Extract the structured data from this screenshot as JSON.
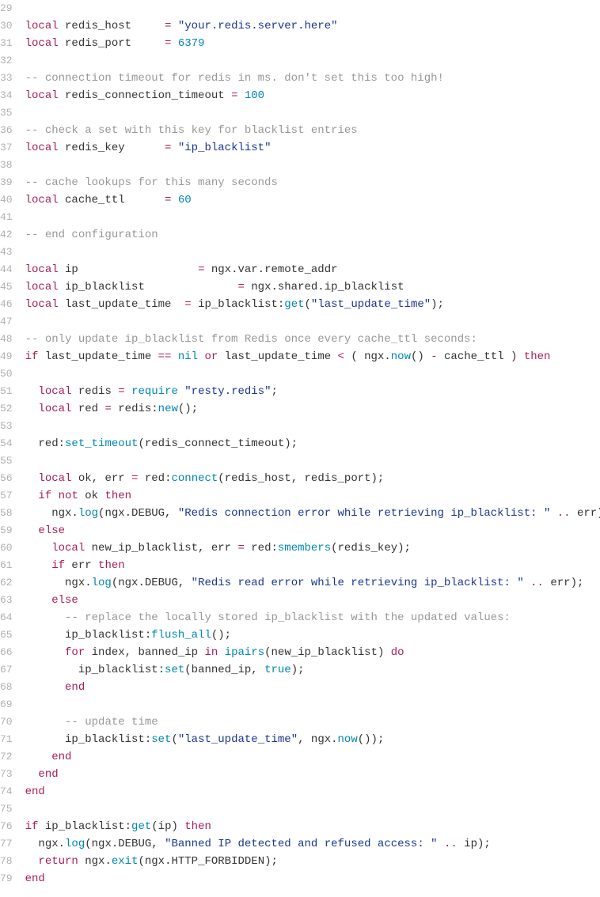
{
  "lines": [
    {
      "n": 29,
      "t": []
    },
    {
      "n": 30,
      "t": [
        {
          "c": "kw",
          "s": "local"
        },
        {
          "c": "id",
          "s": " redis_host     "
        },
        {
          "c": "op",
          "s": "="
        },
        {
          "c": "id",
          "s": " "
        },
        {
          "c": "str",
          "s": "\"your.redis.server.here\""
        }
      ]
    },
    {
      "n": 31,
      "t": [
        {
          "c": "kw",
          "s": "local"
        },
        {
          "c": "id",
          "s": " redis_port     "
        },
        {
          "c": "op",
          "s": "="
        },
        {
          "c": "id",
          "s": " "
        },
        {
          "c": "num",
          "s": "6379"
        }
      ]
    },
    {
      "n": 32,
      "t": []
    },
    {
      "n": 33,
      "t": [
        {
          "c": "com",
          "s": "-- connection timeout for redis in ms. don't set this too high!"
        }
      ]
    },
    {
      "n": 34,
      "t": [
        {
          "c": "kw",
          "s": "local"
        },
        {
          "c": "id",
          "s": " redis_connection_timeout "
        },
        {
          "c": "op",
          "s": "="
        },
        {
          "c": "id",
          "s": " "
        },
        {
          "c": "num",
          "s": "100"
        }
      ]
    },
    {
      "n": 35,
      "t": []
    },
    {
      "n": 36,
      "t": [
        {
          "c": "com",
          "s": "-- check a set with this key for blacklist entries"
        }
      ]
    },
    {
      "n": 37,
      "t": [
        {
          "c": "kw",
          "s": "local"
        },
        {
          "c": "id",
          "s": " redis_key      "
        },
        {
          "c": "op",
          "s": "="
        },
        {
          "c": "id",
          "s": " "
        },
        {
          "c": "str",
          "s": "\"ip_blacklist\""
        }
      ]
    },
    {
      "n": 38,
      "t": []
    },
    {
      "n": 39,
      "t": [
        {
          "c": "com",
          "s": "-- cache lookups for this many seconds"
        }
      ]
    },
    {
      "n": 40,
      "t": [
        {
          "c": "kw",
          "s": "local"
        },
        {
          "c": "id",
          "s": " cache_ttl      "
        },
        {
          "c": "op",
          "s": "="
        },
        {
          "c": "id",
          "s": " "
        },
        {
          "c": "num",
          "s": "60"
        }
      ]
    },
    {
      "n": 41,
      "t": []
    },
    {
      "n": 42,
      "t": [
        {
          "c": "com",
          "s": "-- end configuration"
        }
      ]
    },
    {
      "n": 43,
      "t": []
    },
    {
      "n": 44,
      "t": [
        {
          "c": "kw",
          "s": "local"
        },
        {
          "c": "id",
          "s": " ip                  "
        },
        {
          "c": "op",
          "s": "="
        },
        {
          "c": "id",
          "s": " ngx.var.remote_addr"
        }
      ]
    },
    {
      "n": 45,
      "t": [
        {
          "c": "kw",
          "s": "local"
        },
        {
          "c": "id",
          "s": " ip_blacklist              "
        },
        {
          "c": "op",
          "s": "="
        },
        {
          "c": "id",
          "s": " ngx.shared.ip_blacklist"
        }
      ]
    },
    {
      "n": 46,
      "t": [
        {
          "c": "kw",
          "s": "local"
        },
        {
          "c": "id",
          "s": " last_update_time  "
        },
        {
          "c": "op",
          "s": "="
        },
        {
          "c": "id",
          "s": " ip_blacklist:"
        },
        {
          "c": "fn",
          "s": "get"
        },
        {
          "c": "id",
          "s": "("
        },
        {
          "c": "str",
          "s": "\"last_update_time\""
        },
        {
          "c": "id",
          "s": ");"
        }
      ]
    },
    {
      "n": 47,
      "t": []
    },
    {
      "n": 48,
      "t": [
        {
          "c": "com",
          "s": "-- only update ip_blacklist from Redis once every cache_ttl seconds:"
        }
      ]
    },
    {
      "n": 49,
      "t": [
        {
          "c": "kw",
          "s": "if"
        },
        {
          "c": "id",
          "s": " last_update_time "
        },
        {
          "c": "op",
          "s": "=="
        },
        {
          "c": "id",
          "s": " "
        },
        {
          "c": "nil",
          "s": "nil"
        },
        {
          "c": "id",
          "s": " "
        },
        {
          "c": "kw",
          "s": "or"
        },
        {
          "c": "id",
          "s": " last_update_time "
        },
        {
          "c": "op",
          "s": "<"
        },
        {
          "c": "id",
          "s": " ( ngx."
        },
        {
          "c": "fn",
          "s": "now"
        },
        {
          "c": "id",
          "s": "() "
        },
        {
          "c": "op",
          "s": "-"
        },
        {
          "c": "id",
          "s": " cache_ttl ) "
        },
        {
          "c": "kw",
          "s": "then"
        }
      ]
    },
    {
      "n": 50,
      "t": []
    },
    {
      "n": 51,
      "t": [
        {
          "c": "id",
          "s": "  "
        },
        {
          "c": "kw",
          "s": "local"
        },
        {
          "c": "id",
          "s": " redis "
        },
        {
          "c": "op",
          "s": "="
        },
        {
          "c": "id",
          "s": " "
        },
        {
          "c": "fn",
          "s": "require"
        },
        {
          "c": "id",
          "s": " "
        },
        {
          "c": "str",
          "s": "\"resty.redis\""
        },
        {
          "c": "id",
          "s": ";"
        }
      ]
    },
    {
      "n": 52,
      "t": [
        {
          "c": "id",
          "s": "  "
        },
        {
          "c": "kw",
          "s": "local"
        },
        {
          "c": "id",
          "s": " red "
        },
        {
          "c": "op",
          "s": "="
        },
        {
          "c": "id",
          "s": " redis:"
        },
        {
          "c": "fn",
          "s": "new"
        },
        {
          "c": "id",
          "s": "();"
        }
      ]
    },
    {
      "n": 53,
      "t": []
    },
    {
      "n": 54,
      "t": [
        {
          "c": "id",
          "s": "  red:"
        },
        {
          "c": "fn",
          "s": "set_timeout"
        },
        {
          "c": "id",
          "s": "(redis_connect_timeout);"
        }
      ]
    },
    {
      "n": 55,
      "t": []
    },
    {
      "n": 56,
      "t": [
        {
          "c": "id",
          "s": "  "
        },
        {
          "c": "kw",
          "s": "local"
        },
        {
          "c": "id",
          "s": " ok, err "
        },
        {
          "c": "op",
          "s": "="
        },
        {
          "c": "id",
          "s": " red:"
        },
        {
          "c": "fn",
          "s": "connect"
        },
        {
          "c": "id",
          "s": "(redis_host, redis_port);"
        }
      ]
    },
    {
      "n": 57,
      "t": [
        {
          "c": "id",
          "s": "  "
        },
        {
          "c": "kw",
          "s": "if"
        },
        {
          "c": "id",
          "s": " "
        },
        {
          "c": "kw",
          "s": "not"
        },
        {
          "c": "id",
          "s": " ok "
        },
        {
          "c": "kw",
          "s": "then"
        }
      ]
    },
    {
      "n": 58,
      "t": [
        {
          "c": "id",
          "s": "    ngx."
        },
        {
          "c": "fn",
          "s": "log"
        },
        {
          "c": "id",
          "s": "(ngx.DEBUG, "
        },
        {
          "c": "str",
          "s": "\"Redis connection error while retrieving ip_blacklist: \""
        },
        {
          "c": "id",
          "s": " "
        },
        {
          "c": "op",
          "s": ".."
        },
        {
          "c": "id",
          "s": " err);"
        }
      ]
    },
    {
      "n": 59,
      "t": [
        {
          "c": "id",
          "s": "  "
        },
        {
          "c": "kw",
          "s": "else"
        }
      ]
    },
    {
      "n": 60,
      "t": [
        {
          "c": "id",
          "s": "    "
        },
        {
          "c": "kw",
          "s": "local"
        },
        {
          "c": "id",
          "s": " new_ip_blacklist, err "
        },
        {
          "c": "op",
          "s": "="
        },
        {
          "c": "id",
          "s": " red:"
        },
        {
          "c": "fn",
          "s": "smembers"
        },
        {
          "c": "id",
          "s": "(redis_key);"
        }
      ]
    },
    {
      "n": 61,
      "t": [
        {
          "c": "id",
          "s": "    "
        },
        {
          "c": "kw",
          "s": "if"
        },
        {
          "c": "id",
          "s": " err "
        },
        {
          "c": "kw",
          "s": "then"
        }
      ]
    },
    {
      "n": 62,
      "t": [
        {
          "c": "id",
          "s": "      ngx."
        },
        {
          "c": "fn",
          "s": "log"
        },
        {
          "c": "id",
          "s": "(ngx.DEBUG, "
        },
        {
          "c": "str",
          "s": "\"Redis read error while retrieving ip_blacklist: \""
        },
        {
          "c": "id",
          "s": " "
        },
        {
          "c": "op",
          "s": ".."
        },
        {
          "c": "id",
          "s": " err);"
        }
      ]
    },
    {
      "n": 63,
      "t": [
        {
          "c": "id",
          "s": "    "
        },
        {
          "c": "kw",
          "s": "else"
        }
      ]
    },
    {
      "n": 64,
      "t": [
        {
          "c": "id",
          "s": "      "
        },
        {
          "c": "com",
          "s": "-- replace the locally stored ip_blacklist with the updated values:"
        }
      ]
    },
    {
      "n": 65,
      "t": [
        {
          "c": "id",
          "s": "      ip_blacklist:"
        },
        {
          "c": "fn",
          "s": "flush_all"
        },
        {
          "c": "id",
          "s": "();"
        }
      ]
    },
    {
      "n": 66,
      "t": [
        {
          "c": "id",
          "s": "      "
        },
        {
          "c": "kw",
          "s": "for"
        },
        {
          "c": "id",
          "s": " index, banned_ip "
        },
        {
          "c": "kw",
          "s": "in"
        },
        {
          "c": "id",
          "s": " "
        },
        {
          "c": "fn",
          "s": "ipairs"
        },
        {
          "c": "id",
          "s": "(new_ip_blacklist) "
        },
        {
          "c": "kw",
          "s": "do"
        }
      ]
    },
    {
      "n": 67,
      "t": [
        {
          "c": "id",
          "s": "        ip_blacklist:"
        },
        {
          "c": "fn",
          "s": "set"
        },
        {
          "c": "id",
          "s": "(banned_ip, "
        },
        {
          "c": "bool",
          "s": "true"
        },
        {
          "c": "id",
          "s": ");"
        }
      ]
    },
    {
      "n": 68,
      "t": [
        {
          "c": "id",
          "s": "      "
        },
        {
          "c": "kw",
          "s": "end"
        }
      ]
    },
    {
      "n": 69,
      "t": []
    },
    {
      "n": 70,
      "t": [
        {
          "c": "id",
          "s": "      "
        },
        {
          "c": "com",
          "s": "-- update time"
        }
      ]
    },
    {
      "n": 71,
      "t": [
        {
          "c": "id",
          "s": "      ip_blacklist:"
        },
        {
          "c": "fn",
          "s": "set"
        },
        {
          "c": "id",
          "s": "("
        },
        {
          "c": "str",
          "s": "\"last_update_time\""
        },
        {
          "c": "id",
          "s": ", ngx."
        },
        {
          "c": "fn",
          "s": "now"
        },
        {
          "c": "id",
          "s": "());"
        }
      ]
    },
    {
      "n": 72,
      "t": [
        {
          "c": "id",
          "s": "    "
        },
        {
          "c": "kw",
          "s": "end"
        }
      ]
    },
    {
      "n": 73,
      "t": [
        {
          "c": "id",
          "s": "  "
        },
        {
          "c": "kw",
          "s": "end"
        }
      ]
    },
    {
      "n": 74,
      "t": [
        {
          "c": "kw",
          "s": "end"
        }
      ]
    },
    {
      "n": 75,
      "t": []
    },
    {
      "n": 76,
      "t": [
        {
          "c": "kw",
          "s": "if"
        },
        {
          "c": "id",
          "s": " ip_blacklist:"
        },
        {
          "c": "fn",
          "s": "get"
        },
        {
          "c": "id",
          "s": "(ip) "
        },
        {
          "c": "kw",
          "s": "then"
        }
      ]
    },
    {
      "n": 77,
      "t": [
        {
          "c": "id",
          "s": "  ngx."
        },
        {
          "c": "fn",
          "s": "log"
        },
        {
          "c": "id",
          "s": "(ngx.DEBUG, "
        },
        {
          "c": "str",
          "s": "\"Banned IP detected and refused access: \""
        },
        {
          "c": "id",
          "s": " "
        },
        {
          "c": "op",
          "s": ".."
        },
        {
          "c": "id",
          "s": " ip);"
        }
      ]
    },
    {
      "n": 78,
      "t": [
        {
          "c": "id",
          "s": "  "
        },
        {
          "c": "kw",
          "s": "return"
        },
        {
          "c": "id",
          "s": " ngx."
        },
        {
          "c": "fn",
          "s": "exit"
        },
        {
          "c": "id",
          "s": "(ngx.HTTP_FORBIDDEN);"
        }
      ]
    },
    {
      "n": 79,
      "t": [
        {
          "c": "kw",
          "s": "end"
        }
      ]
    }
  ]
}
